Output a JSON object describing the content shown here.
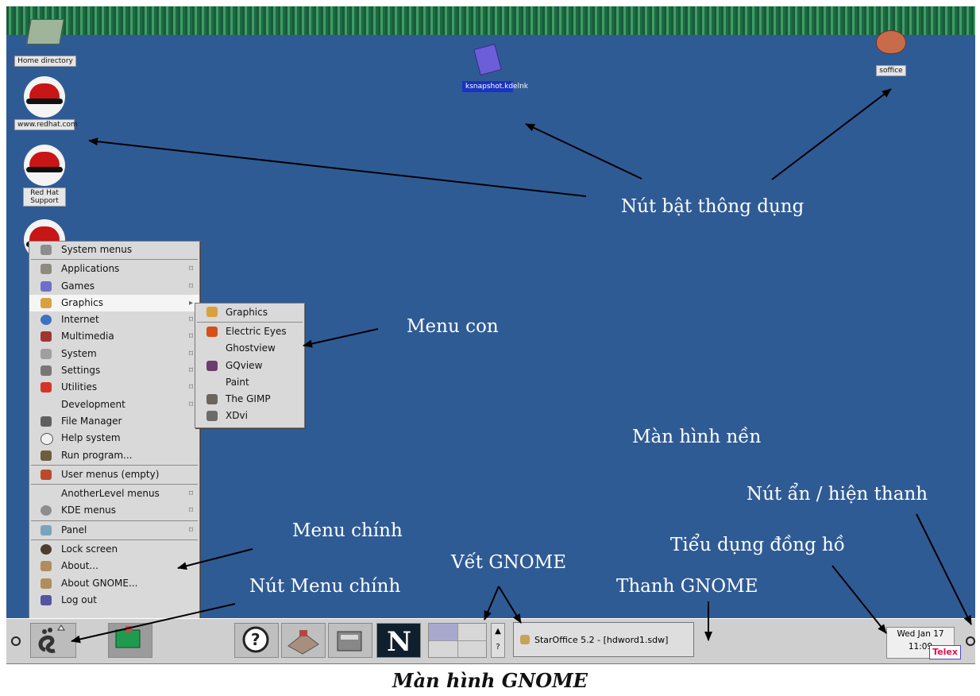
{
  "desktop_icons": {
    "home": "Home directory",
    "redhat_com": "www.redhat.com",
    "redhat_support": "Red Hat Support",
    "snapshot": "ksnapshot.kdelnk",
    "soffice": "soffice"
  },
  "main_menu": {
    "items": [
      {
        "label": "System menus",
        "icon": "settings-icon",
        "submenu": false
      },
      {
        "label": "Applications",
        "icon": "applications-icon",
        "submenu": true
      },
      {
        "label": "Games",
        "icon": "games-icon",
        "submenu": true
      },
      {
        "label": "Graphics",
        "icon": "graphics-icon",
        "submenu": true,
        "selected": true
      },
      {
        "label": "Internet",
        "icon": "internet-icon",
        "submenu": true
      },
      {
        "label": "Multimedia",
        "icon": "multimedia-icon",
        "submenu": true
      },
      {
        "label": "System",
        "icon": "system-icon",
        "submenu": true
      },
      {
        "label": "Settings",
        "icon": "settings-icon",
        "submenu": true
      },
      {
        "label": "Utilities",
        "icon": "utilities-icon",
        "submenu": true
      },
      {
        "label": "Development",
        "icon": "development-icon",
        "submenu": true
      },
      {
        "label": "File Manager",
        "icon": "file-manager-icon",
        "submenu": false
      },
      {
        "label": "Help system",
        "icon": "help-icon",
        "submenu": false
      },
      {
        "label": "Run program...",
        "icon": "run-icon",
        "submenu": false
      },
      {
        "label": "User menus (empty)",
        "icon": "user-menus-icon",
        "submenu": false
      },
      {
        "label": "AnotherLevel menus",
        "icon": "anotherlevel-icon",
        "submenu": true
      },
      {
        "label": "KDE menus",
        "icon": "kde-icon",
        "submenu": true
      },
      {
        "label": "Panel",
        "icon": "panel-icon",
        "submenu": true
      },
      {
        "label": "Lock screen",
        "icon": "lock-icon",
        "submenu": false
      },
      {
        "label": "About...",
        "icon": "about-icon",
        "submenu": false
      },
      {
        "label": "About GNOME...",
        "icon": "about-gnome-icon",
        "submenu": false
      },
      {
        "label": "Log out",
        "icon": "logout-icon",
        "submenu": false
      }
    ]
  },
  "graphics_submenu": {
    "items": [
      {
        "label": "Graphics",
        "icon": "graphics-icon"
      },
      {
        "label": "Electric Eyes",
        "icon": "electric-eyes-icon"
      },
      {
        "label": "Ghostview",
        "icon": ""
      },
      {
        "label": "GQview",
        "icon": "gqview-icon"
      },
      {
        "label": "Paint",
        "icon": ""
      },
      {
        "label": "The GIMP",
        "icon": "gimp-icon"
      },
      {
        "label": "XDvi",
        "icon": "xdvi-icon"
      }
    ]
  },
  "panel": {
    "task_label": "StarOffice 5.2 - [hdword1.sdw]",
    "clock_date": "Wed Jan 17",
    "clock_time": "11:09",
    "badge": "Telex"
  },
  "annotations": {
    "launchers": "Nút bật thông dụng",
    "submenu": "Menu con",
    "desktop": "Màn hình nền",
    "hide_panel": "Nút ẩn / hiện thanh",
    "main_menu": "Menu chính",
    "clock_applet": "Tiểu dụng đồng hồ",
    "gnome_pager": "Vết GNOME",
    "main_menu_button": "Nút Menu chính",
    "gnome_panel": "Thanh GNOME"
  },
  "caption": "Màn hình GNOME",
  "colors": {
    "desktop": "#2f5b95",
    "panel": "#cfcfcf",
    "menu": "#d9d9d9",
    "annotation_text": "#ffffff",
    "telex_text": "#e0104a"
  }
}
